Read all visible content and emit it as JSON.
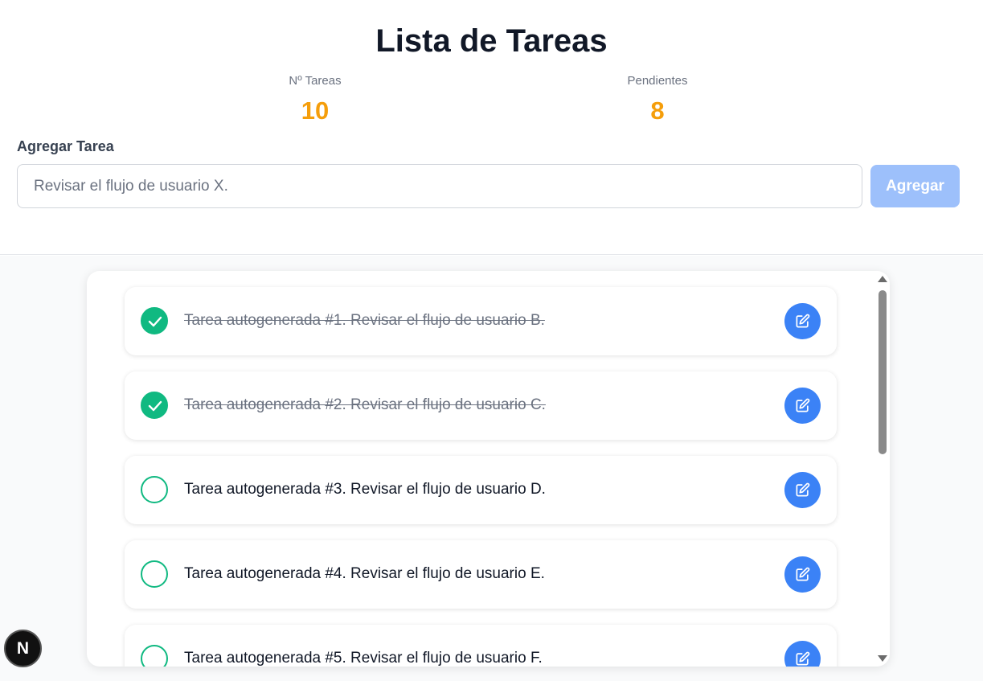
{
  "header": {
    "title": "Lista de Tareas",
    "stats": {
      "total_label": "Nº Tareas",
      "total_value": "10",
      "pending_label": "Pendientes",
      "pending_value": "8"
    },
    "add": {
      "label": "Agregar Tarea",
      "input_placeholder": "Revisar el flujo de usuario X.",
      "button_label": "Agregar"
    }
  },
  "tasks": [
    {
      "text": "Tarea autogenerada #1. Revisar el flujo de usuario B.",
      "done": true
    },
    {
      "text": "Tarea autogenerada #2. Revisar el flujo de usuario C.",
      "done": true
    },
    {
      "text": "Tarea autogenerada #3. Revisar el flujo de usuario D.",
      "done": false
    },
    {
      "text": "Tarea autogenerada #4. Revisar el flujo de usuario E.",
      "done": false
    },
    {
      "text": "Tarea autogenerada #5. Revisar el flujo de usuario F.",
      "done": false
    }
  ],
  "badge": {
    "label": "N"
  },
  "colors": {
    "accent_orange": "#f59e0b",
    "check_green": "#10b981",
    "edit_blue": "#3b82f6",
    "button_disabled_blue": "#9dc0fb"
  },
  "icons": {
    "check": "check-icon",
    "edit": "pencil-square-icon",
    "scroll_up": "chevron-up-icon",
    "scroll_down": "chevron-down-icon"
  }
}
